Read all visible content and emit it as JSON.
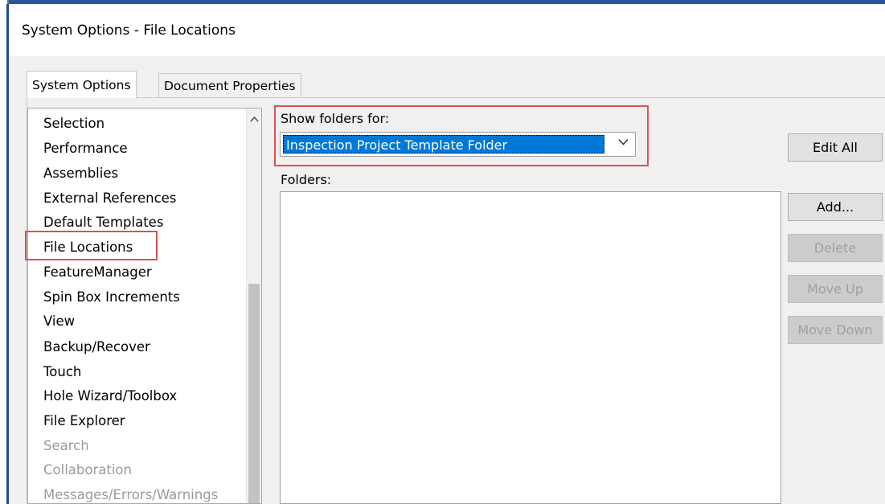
{
  "window": {
    "title": "System Options - File Locations"
  },
  "tabs": [
    {
      "label": "System Options",
      "selected": true
    },
    {
      "label": "Document Properties",
      "selected": false
    }
  ],
  "categories": [
    {
      "label": "Selection",
      "enabled": true
    },
    {
      "label": "Performance",
      "enabled": true
    },
    {
      "label": "Assemblies",
      "enabled": true
    },
    {
      "label": "External References",
      "enabled": true
    },
    {
      "label": "Default Templates",
      "enabled": true
    },
    {
      "label": "File Locations",
      "enabled": true,
      "selected": true
    },
    {
      "label": "FeatureManager",
      "enabled": true
    },
    {
      "label": "Spin Box Increments",
      "enabled": true
    },
    {
      "label": "View",
      "enabled": true
    },
    {
      "label": "Backup/Recover",
      "enabled": true
    },
    {
      "label": "Touch",
      "enabled": true
    },
    {
      "label": "Hole Wizard/Toolbox",
      "enabled": true
    },
    {
      "label": "File Explorer",
      "enabled": true
    },
    {
      "label": "Search",
      "enabled": false
    },
    {
      "label": "Collaboration",
      "enabled": false
    },
    {
      "label": "Messages/Errors/Warnings",
      "enabled": false
    }
  ],
  "show_folders": {
    "label": "Show folders for:",
    "selected_value": "Inspection Project Template Folder"
  },
  "folders": {
    "label": "Folders:"
  },
  "buttons": {
    "edit_all": "Edit All",
    "add": "Add...",
    "delete": "Delete",
    "move_up": "Move Up",
    "move_down": "Move Down"
  },
  "icons": {
    "scroll_up": "chevron-up-icon",
    "dropdown": "chevron-down-icon"
  },
  "colors": {
    "selection": "#0078d7",
    "highlight": "#d9534f",
    "window_border": "#2b579a"
  }
}
